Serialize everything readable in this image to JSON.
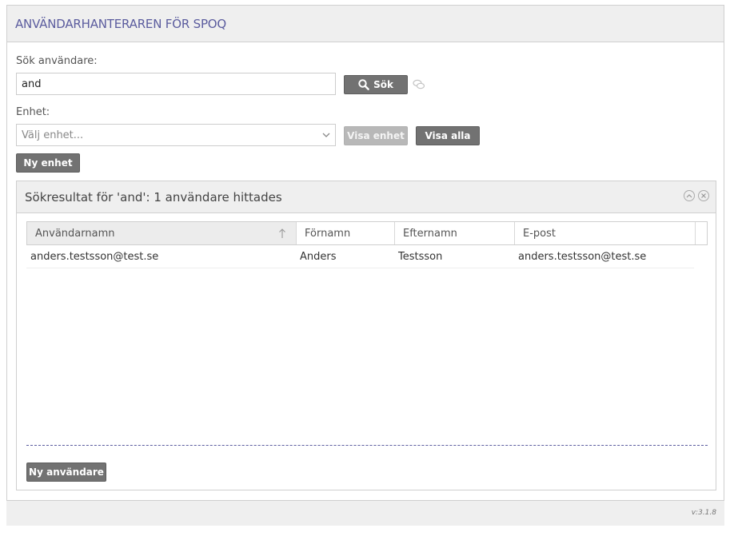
{
  "app": {
    "title": "ANVÄNDARHANTERAREN FÖR SPOQ",
    "version": "v:3.1.8"
  },
  "search": {
    "label": "Sök användare:",
    "value": "and",
    "button_label": "Sök"
  },
  "unit": {
    "label": "Enhet:",
    "placeholder": "Välj enhet...",
    "show_unit_label": "Visa enhet",
    "show_all_label": "Visa alla",
    "new_unit_label": "Ny enhet"
  },
  "results": {
    "title": "Sökresultat för 'and': 1 användare hittades",
    "columns": [
      "Användarnamn",
      "Förnamn",
      "Efternamn",
      "E-post"
    ],
    "rows": [
      [
        "anders.testsson@test.se",
        "Anders",
        "Testsson",
        "anders.testsson@test.se"
      ]
    ],
    "new_user_label": "Ny användare"
  },
  "colors": {
    "accent": "#5b5c9e",
    "button": "#727272",
    "button_disabled": "#b8b8b8",
    "header_bg": "#efefef"
  },
  "icons": [
    "search-icon",
    "chat-bubbles-icon",
    "chevron-down-icon",
    "sort-up-arrow-icon",
    "collapse-icon",
    "close-icon"
  ]
}
